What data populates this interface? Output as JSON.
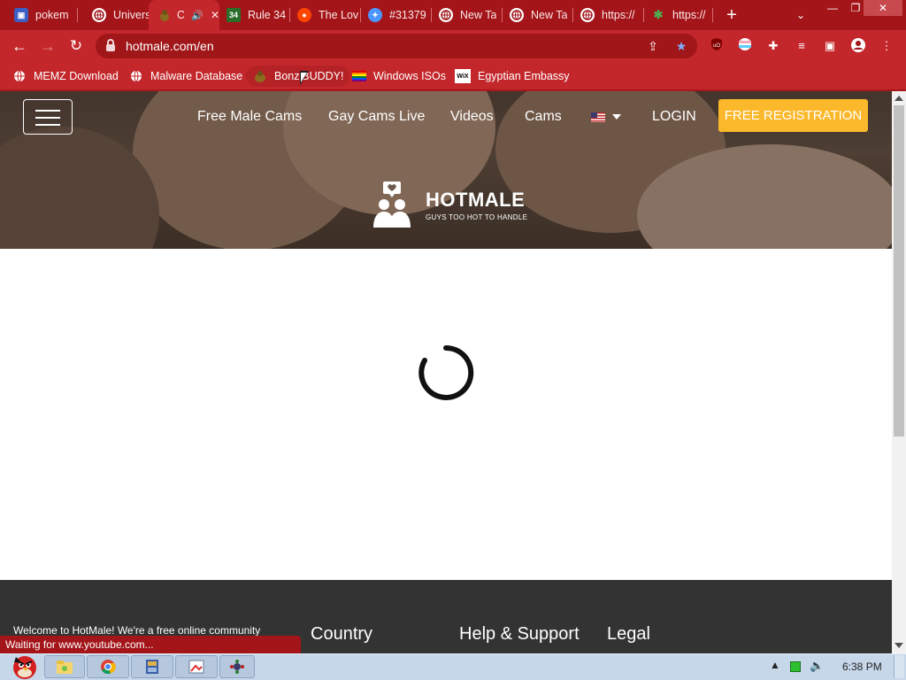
{
  "browser": {
    "tabs": [
      {
        "label": "pokem",
        "icon": "pokemon-icon",
        "color": "#3b5fc4"
      },
      {
        "label": "Univers",
        "icon": "globe-icon",
        "color": "#ffffff"
      },
      {
        "label": "C",
        "icon": "bonzi-icon",
        "color": "#8a6d1f"
      },
      {
        "label": "Rule 34",
        "icon": "rule34-icon",
        "color": "#2a6e2a"
      },
      {
        "label": "The Lov",
        "icon": "reddit-icon",
        "color": "#ff4500"
      },
      {
        "label": "#31379",
        "icon": "scratch-icon",
        "color": "#4c97ff"
      },
      {
        "label": "New Ta",
        "icon": "globe-icon",
        "color": "#ffffff"
      },
      {
        "label": "New Ta",
        "icon": "globe-icon",
        "color": "#ffffff"
      },
      {
        "label": "https://",
        "icon": "globe-icon",
        "color": "#ffffff"
      },
      {
        "label": "https://",
        "icon": "puzzle-icon",
        "color": "#4caf50"
      }
    ],
    "active_tab_close": "✕",
    "active_tab_audio": "🔊",
    "url": "hotmale.com/en",
    "new_tab": "+",
    "window_controls": [
      "—",
      "❐",
      "✕"
    ]
  },
  "bookmarks": [
    {
      "label": "MEMZ Download",
      "icon": "globe-icon"
    },
    {
      "label": "Malware Database",
      "icon": "globe-icon"
    },
    {
      "label": "BonziBUDDY!",
      "icon": "bonzi-icon"
    },
    {
      "label": "Windows ISOs",
      "icon": "rainbow-flag-icon"
    },
    {
      "label": "Egyptian Embassy",
      "icon": "wix-icon"
    }
  ],
  "page": {
    "nav": {
      "links": [
        "Free Male Cams",
        "Gay Cams Live",
        "Videos",
        "Cams"
      ],
      "login": "LOGIN",
      "register": "FREE REGISTRATION"
    },
    "brand": "HOTMALE",
    "tagline": "GUYS TOO HOT TO HANDLE",
    "footer": {
      "intro": "Welcome to HotMale! We're a free online community",
      "headings": [
        "Country",
        "Help & Support",
        "Legal"
      ]
    }
  },
  "status_text": "Waiting for www.youtube.com...",
  "taskbar": {
    "clock": "6:38 PM"
  },
  "colors": {
    "accent": "#c3272b",
    "register_button": "#fbb82a",
    "footer": "#333333"
  }
}
